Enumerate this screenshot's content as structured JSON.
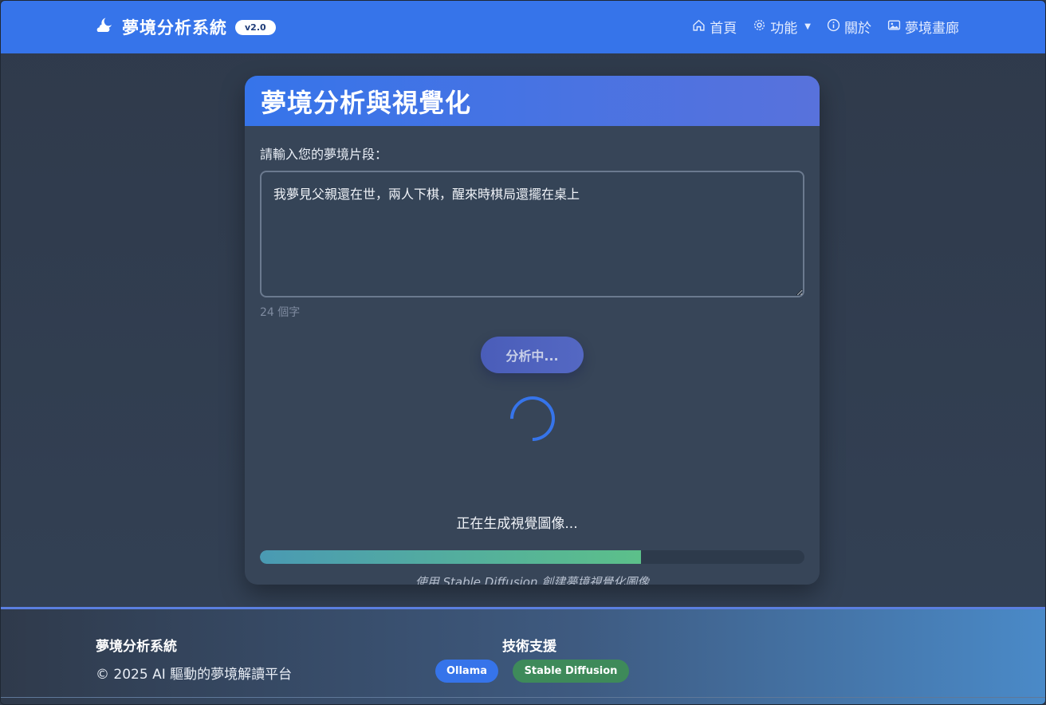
{
  "navbar": {
    "brand_title": "夢境分析系統",
    "version": "v2.0",
    "items": [
      {
        "label": "首頁",
        "icon": "home-icon"
      },
      {
        "label": "功能",
        "icon": "gear-icon"
      },
      {
        "label": "關於",
        "icon": "info-icon"
      },
      {
        "label": "夢境畫廊",
        "icon": "image-icon"
      }
    ]
  },
  "card": {
    "title": "夢境分析與視覺化",
    "input_label": "請輸入您的夢境片段：",
    "input_value": "我夢見父親還在世，兩人下棋，醒來時棋局還擺在桌上",
    "char_count": "24 個字",
    "analyze_button": "分析中...",
    "status_text": "正在生成視覺圖像...",
    "progress_fraction": 0.7,
    "progress_caption": "使用 Stable Diffusion 創建夢境視覺化圖像"
  },
  "footer": {
    "brand": "夢境分析系統",
    "copyright": "© 2025 AI 驅動的夢境解讀平台",
    "tech_title": "技術支援",
    "badges": [
      "Ollama",
      "Stable Diffusion"
    ]
  },
  "colors": {
    "primary": "#3674ea",
    "background": "#2f3a4b",
    "card": "#374558",
    "progress_start": "#4a9ab3",
    "progress_end": "#5cc08a",
    "sd_badge": "#3e8a5a"
  }
}
